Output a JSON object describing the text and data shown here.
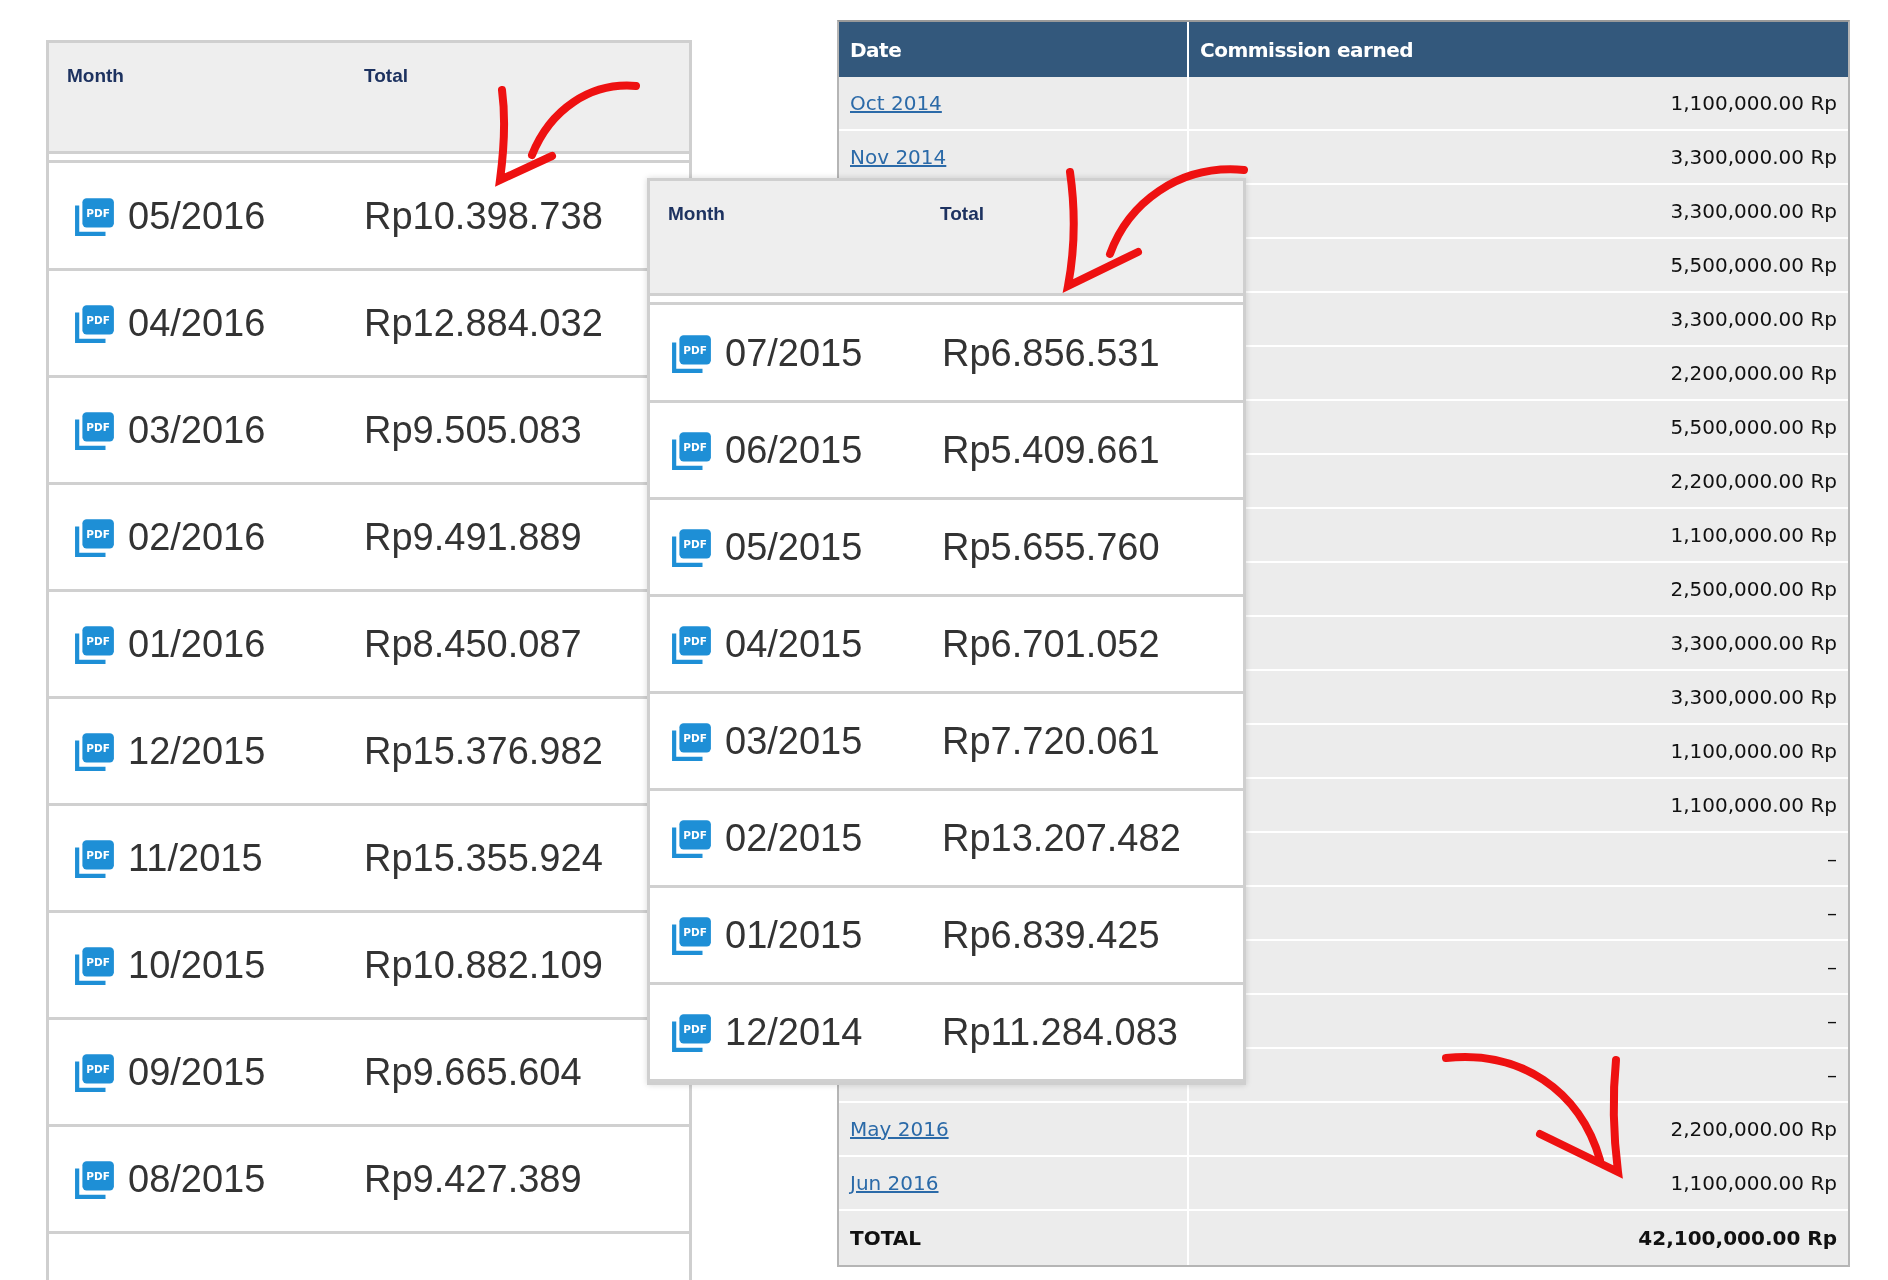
{
  "commission_table": {
    "columns": [
      "Date",
      "Commission earned"
    ],
    "rows": [
      {
        "date": "Oct 2014",
        "amount": "1,100,000.00 Rp"
      },
      {
        "date": "Nov 2014",
        "amount": "3,300,000.00 Rp"
      },
      {
        "amount": "3,300,000.00 Rp"
      },
      {
        "amount": "5,500,000.00 Rp"
      },
      {
        "amount": "3,300,000.00 Rp"
      },
      {
        "amount": "2,200,000.00 Rp"
      },
      {
        "amount": "5,500,000.00 Rp"
      },
      {
        "amount": "2,200,000.00 Rp"
      },
      {
        "amount": "1,100,000.00 Rp"
      },
      {
        "amount": "2,500,000.00 Rp"
      },
      {
        "amount": "3,300,000.00 Rp"
      },
      {
        "amount": "3,300,000.00 Rp"
      },
      {
        "amount": "1,100,000.00 Rp"
      },
      {
        "amount": "1,100,000.00 Rp"
      },
      {
        "amount": "–"
      },
      {
        "amount": "–"
      },
      {
        "amount": "–"
      },
      {
        "amount": "–"
      },
      {
        "amount": "–"
      },
      {
        "date": "May 2016",
        "amount": "2,200,000.00 Rp"
      },
      {
        "date": "Jun 2016",
        "amount": "1,100,000.00 Rp"
      }
    ],
    "total_row": {
      "label": "TOTAL",
      "amount": "42,100,000.00 Rp"
    }
  },
  "statements_2016": {
    "columns": [
      "Month",
      "Total"
    ],
    "rows": [
      {
        "icon_label": "PDF",
        "month": "05/2016",
        "total": "Rp10.398.738"
      },
      {
        "icon_label": "PDF",
        "month": "04/2016",
        "total": "Rp12.884.032"
      },
      {
        "icon_label": "PDF",
        "month": "03/2016",
        "total": "Rp9.505.083"
      },
      {
        "icon_label": "PDF",
        "month": "02/2016",
        "total": "Rp9.491.889"
      },
      {
        "icon_label": "PDF",
        "month": "01/2016",
        "total": "Rp8.450.087"
      },
      {
        "icon_label": "PDF",
        "month": "12/2015",
        "total": "Rp15.376.982"
      },
      {
        "icon_label": "PDF",
        "month": "11/2015",
        "total": "Rp15.355.924"
      },
      {
        "icon_label": "PDF",
        "month": "10/2015",
        "total": "Rp10.882.109"
      },
      {
        "icon_label": "PDF",
        "month": "09/2015",
        "total": "Rp9.665.604"
      },
      {
        "icon_label": "PDF",
        "month": "08/2015",
        "total": "Rp9.427.389"
      }
    ]
  },
  "statements_2015": {
    "columns": [
      "Month",
      "Total"
    ],
    "rows": [
      {
        "icon_label": "PDF",
        "month": "07/2015",
        "total": "Rp6.856.531"
      },
      {
        "icon_label": "PDF",
        "month": "06/2015",
        "total": "Rp5.409.661"
      },
      {
        "icon_label": "PDF",
        "month": "05/2015",
        "total": "Rp5.655.760"
      },
      {
        "icon_label": "PDF",
        "month": "04/2015",
        "total": "Rp6.701.052"
      },
      {
        "icon_label": "PDF",
        "month": "03/2015",
        "total": "Rp7.720.061"
      },
      {
        "icon_label": "PDF",
        "month": "02/2015",
        "total": "Rp13.207.482"
      },
      {
        "icon_label": "PDF",
        "month": "01/2015",
        "total": "Rp6.839.425"
      },
      {
        "icon_label": "PDF",
        "month": "12/2014",
        "total": "Rp11.284.083"
      }
    ]
  }
}
